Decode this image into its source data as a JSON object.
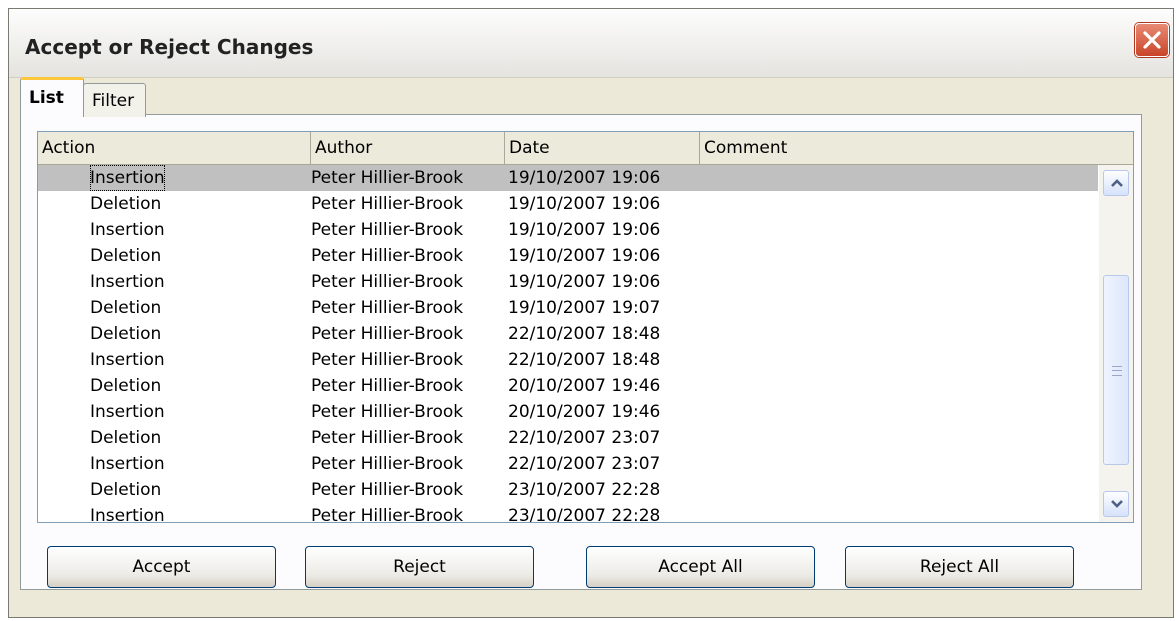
{
  "window": {
    "title": "Accept or Reject Changes",
    "close_icon": "close-icon"
  },
  "tabs": [
    {
      "label": "List",
      "active": true
    },
    {
      "label": "Filter",
      "active": false
    }
  ],
  "table": {
    "columns": [
      "Action",
      "Author",
      "Date",
      "Comment"
    ],
    "rows": [
      {
        "action": "Insertion",
        "author": "Peter Hillier-Brook",
        "date": "19/10/2007 19:06",
        "comment": ""
      },
      {
        "action": "Deletion",
        "author": "Peter Hillier-Brook",
        "date": "19/10/2007 19:06",
        "comment": ""
      },
      {
        "action": "Insertion",
        "author": "Peter Hillier-Brook",
        "date": "19/10/2007 19:06",
        "comment": ""
      },
      {
        "action": "Deletion",
        "author": "Peter Hillier-Brook",
        "date": "19/10/2007 19:06",
        "comment": ""
      },
      {
        "action": "Insertion",
        "author": "Peter Hillier-Brook",
        "date": "19/10/2007 19:06",
        "comment": ""
      },
      {
        "action": "Deletion",
        "author": "Peter Hillier-Brook",
        "date": "19/10/2007 19:07",
        "comment": ""
      },
      {
        "action": "Deletion",
        "author": "Peter Hillier-Brook",
        "date": "22/10/2007 18:48",
        "comment": ""
      },
      {
        "action": "Insertion",
        "author": "Peter Hillier-Brook",
        "date": "22/10/2007 18:48",
        "comment": ""
      },
      {
        "action": "Deletion",
        "author": "Peter Hillier-Brook",
        "date": "20/10/2007 19:46",
        "comment": ""
      },
      {
        "action": "Insertion",
        "author": "Peter Hillier-Brook",
        "date": "20/10/2007 19:46",
        "comment": ""
      },
      {
        "action": "Deletion",
        "author": "Peter Hillier-Brook",
        "date": "22/10/2007 23:07",
        "comment": ""
      },
      {
        "action": "Insertion",
        "author": "Peter Hillier-Brook",
        "date": "22/10/2007 23:07",
        "comment": ""
      },
      {
        "action": "Deletion",
        "author": "Peter Hillier-Brook",
        "date": "23/10/2007 22:28",
        "comment": ""
      },
      {
        "action": "Insertion",
        "author": "Peter Hillier-Brook",
        "date": "23/10/2007 22:28",
        "comment": ""
      }
    ],
    "selected_index": 0
  },
  "buttons": {
    "accept": "Accept",
    "reject": "Reject",
    "accept_all": "Accept All",
    "reject_all": "Reject All"
  },
  "colors": {
    "selection": "#c0c0c0",
    "active_tab_accent": "#ffc83c",
    "close_button": "#c9452a"
  }
}
